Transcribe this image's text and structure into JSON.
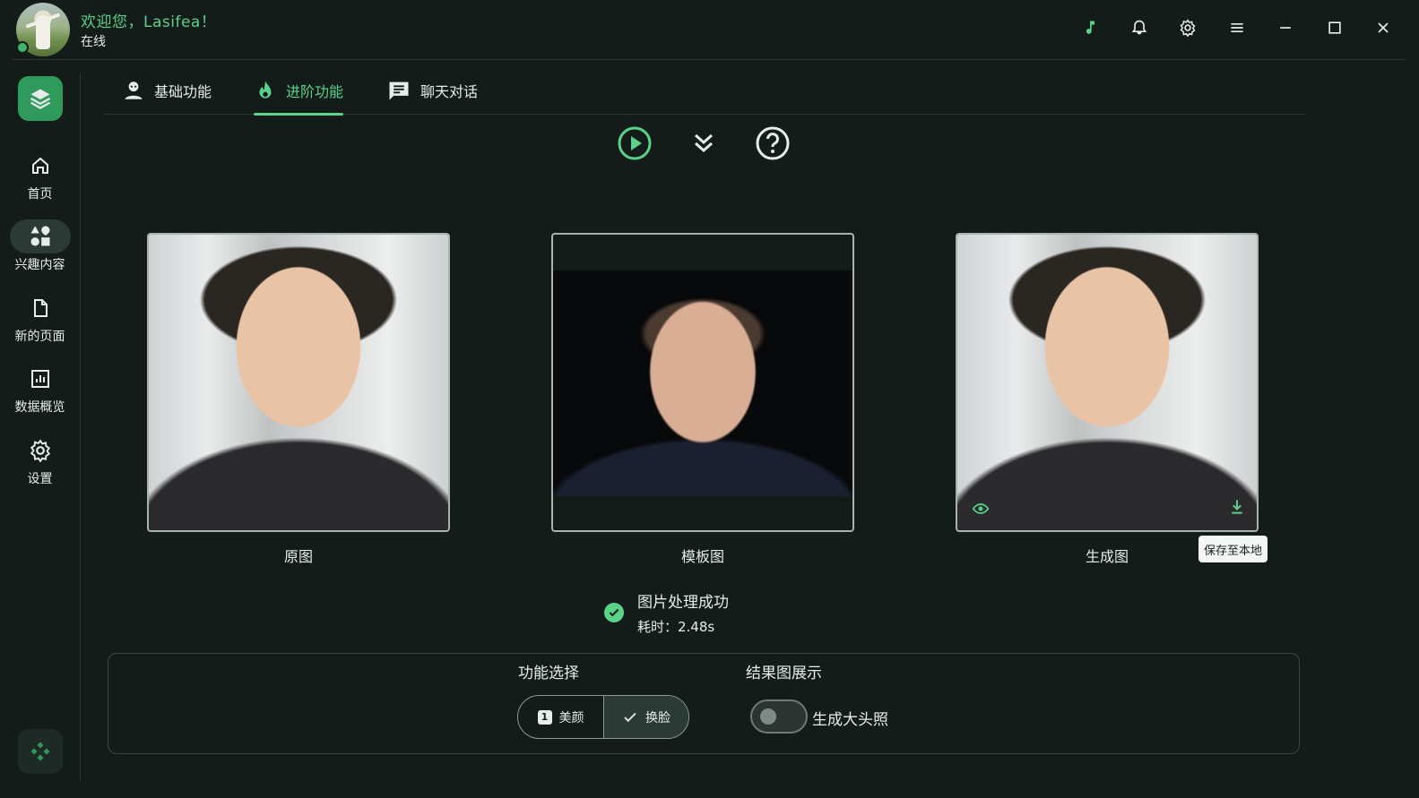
{
  "header": {
    "welcome": "欢迎您，Lasifea！",
    "status": "在线",
    "icons": [
      "music-icon",
      "bell-icon",
      "settings-icon",
      "menu-icon",
      "minimize-icon",
      "maximize-icon",
      "close-icon"
    ]
  },
  "sidebar": {
    "items": [
      {
        "label": "首页",
        "icon": "home-icon"
      },
      {
        "label": "兴趣内容",
        "icon": "shapes-icon",
        "active": true
      },
      {
        "label": "新的页面",
        "icon": "file-icon"
      },
      {
        "label": "数据概览",
        "icon": "chart-icon"
      },
      {
        "label": "设置",
        "icon": "gear-icon"
      }
    ]
  },
  "tabs": [
    {
      "label": "基础功能",
      "icon": "face-retouch-icon"
    },
    {
      "label": "进阶功能",
      "icon": "flame-icon",
      "active": true
    },
    {
      "label": "聊天对话",
      "icon": "chat-icon"
    }
  ],
  "images": {
    "original": "原图",
    "template": "模板图",
    "result": "生成图",
    "tooltip": "保存至本地"
  },
  "result": {
    "title": "图片处理成功",
    "time": "耗时：2.48s"
  },
  "panel": {
    "function_label": "功能选择",
    "display_label": "结果图展示",
    "options": [
      {
        "label": "美颜",
        "badge": "1",
        "selected": false
      },
      {
        "label": "换脸",
        "selected": true
      }
    ],
    "toggle_label": "生成大头照",
    "toggle_on": false
  },
  "colors": {
    "accent": "#59d38a",
    "background": "#141c19",
    "logo": "#2f9a5c"
  }
}
